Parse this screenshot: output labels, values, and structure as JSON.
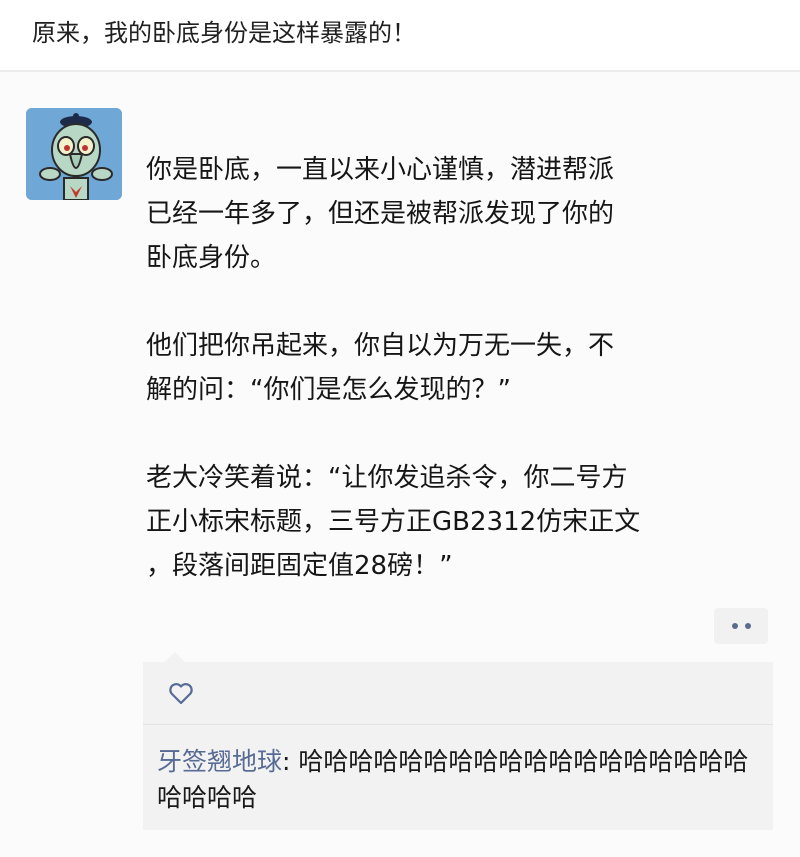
{
  "headline": "原来，我的卧底身份是这样暴露的！",
  "post": {
    "paragraphs": [
      "你是卧底，一直以来小心谨慎，潜进帮派\n已经一年多了，但还是被帮派发现了你的\n卧底身份。",
      "他们把你吊起来，你自以为万无一失，不\n解的问：“你们是怎么发现的？”",
      "老大冷笑着说：“让你发追杀令，你二号方\n正小标宋标题，三号方正GB2312仿宋正文\n，段落间距固定值28磅！”"
    ]
  },
  "icons": {
    "avatar": "squidward-avatar",
    "more": "more-dots-icon",
    "like": "heart-icon"
  },
  "comment": {
    "author": "牙签翘地球",
    "separator": ": ",
    "text": "哈哈哈哈哈哈哈哈哈哈哈哈哈哈哈哈哈哈哈哈哈哈"
  },
  "colors": {
    "author_link": "#576b95",
    "avatar_bg": "#6fa8d6",
    "comment_bg": "#f2f2f2"
  }
}
